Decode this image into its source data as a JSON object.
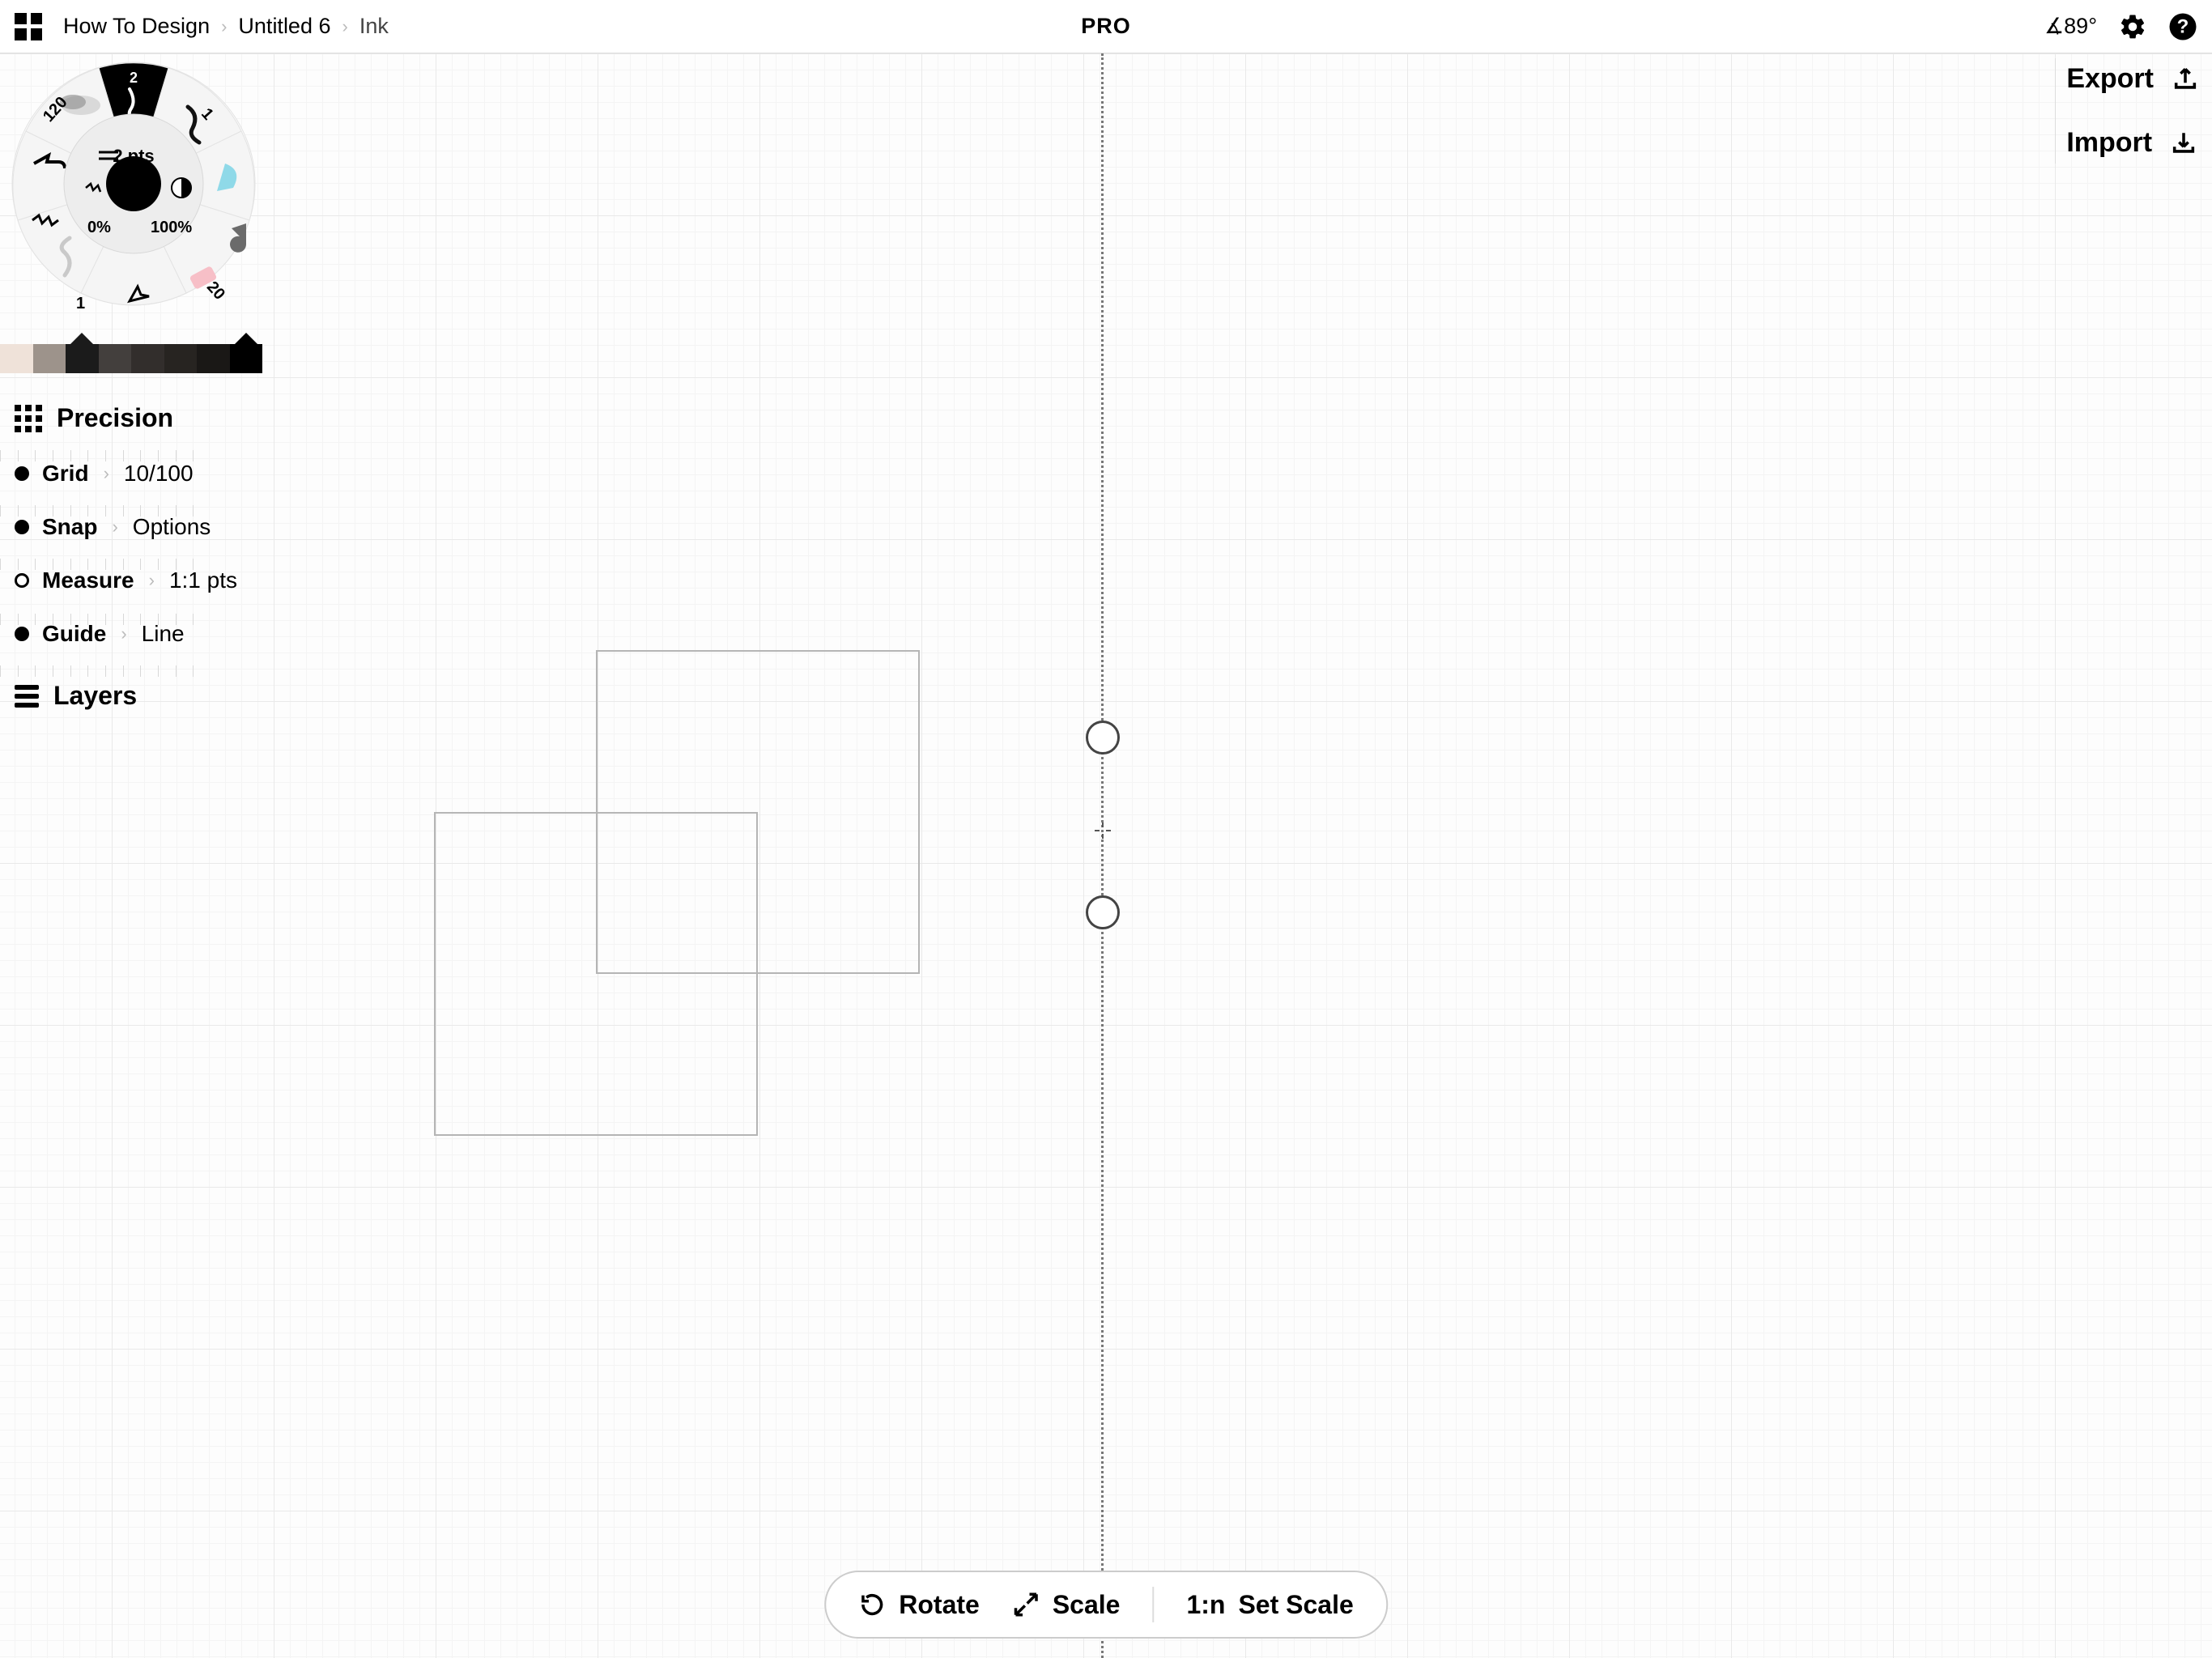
{
  "breadcrumbs": {
    "root": "How To Design",
    "doc": "Untitled 6",
    "tool": "Ink"
  },
  "header": {
    "pro": "PRO",
    "angle": "∡89°"
  },
  "io": {
    "export": "Export",
    "import": "Import"
  },
  "wheel": {
    "size_label": "2 pts",
    "seg_pen": "2",
    "seg_penL": "120",
    "seg_penR": "1",
    "seg_eraser": "20",
    "seg_bottom": "1",
    "min_pct": "0%",
    "max_pct": "100%"
  },
  "palette": [
    {
      "hex": "#efe2d9"
    },
    {
      "hex": "#9d938b"
    },
    {
      "hex": "#1b1b1b",
      "active": true
    },
    {
      "hex": "#433f3d"
    },
    {
      "hex": "#322e2c"
    },
    {
      "hex": "#272421"
    },
    {
      "hex": "#1a1816"
    },
    {
      "hex": "#000000",
      "active": true
    }
  ],
  "precision": {
    "title": "Precision",
    "grid": {
      "label": "Grid",
      "value": "10/100",
      "on": true
    },
    "snap": {
      "label": "Snap",
      "value": "Options",
      "on": true
    },
    "measure": {
      "label": "Measure",
      "value": "1:1 pts",
      "on": false
    },
    "guide": {
      "label": "Guide",
      "value": "Line",
      "on": true
    },
    "layers": "Layers"
  },
  "bottombar": {
    "rotate": "Rotate",
    "scale": "Scale",
    "ratio": "1:n",
    "setscale": "Set Scale"
  }
}
